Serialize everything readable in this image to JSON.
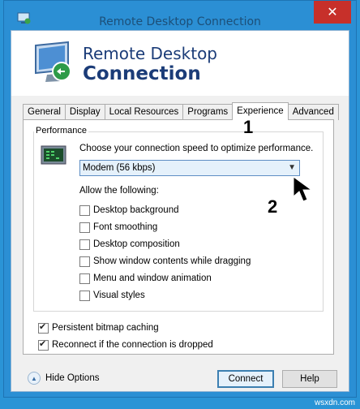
{
  "window": {
    "title": "Remote Desktop Connection",
    "close_label": "✕"
  },
  "banner": {
    "line1": "Remote Desktop",
    "line2": "Connection"
  },
  "tabs": [
    {
      "label": "General"
    },
    {
      "label": "Display"
    },
    {
      "label": "Local Resources"
    },
    {
      "label": "Programs"
    },
    {
      "label": "Experience",
      "active": true
    },
    {
      "label": "Advanced"
    }
  ],
  "performance": {
    "group_title": "Performance",
    "prompt": "Choose your connection speed to optimize performance.",
    "speed_selected": "Modem (56 kbps)",
    "allow_label": "Allow the following:",
    "options": [
      {
        "label": "Desktop background",
        "checked": false
      },
      {
        "label": "Font smoothing",
        "checked": false
      },
      {
        "label": "Desktop composition",
        "checked": false
      },
      {
        "label": "Show window contents while dragging",
        "checked": false
      },
      {
        "label": "Menu and window animation",
        "checked": false
      },
      {
        "label": "Visual styles",
        "checked": false
      }
    ]
  },
  "persistent": {
    "label": "Persistent bitmap caching",
    "checked": true
  },
  "reconnect": {
    "label": "Reconnect if the connection is dropped",
    "checked": true
  },
  "footer": {
    "hide_options": "Hide Options",
    "connect": "Connect",
    "help": "Help"
  },
  "annotations": {
    "one": "1",
    "two": "2"
  },
  "watermark": "wsxdn.com"
}
